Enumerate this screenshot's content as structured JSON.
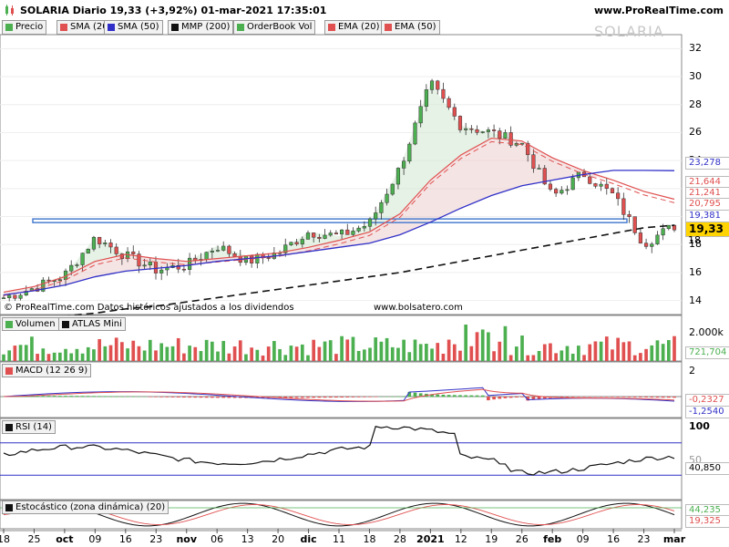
{
  "header": {
    "title": "SOLARIA Diario 19,33 (+3,92%) 01-mar-2021 17:35:01",
    "site": "www.ProRealTime.com"
  },
  "legend": [
    {
      "label": "Precio",
      "color": "#4caf50"
    },
    {
      "label": "SMA (20)",
      "color": "#e05050"
    },
    {
      "label": "SMA (50)",
      "color": "#3030c8"
    },
    {
      "label": "MMP (200)",
      "color": "#111111"
    },
    {
      "label": "OrderBook Vol",
      "color": "#4caf50"
    },
    {
      "label": "EMA (20)",
      "color": "#e05050"
    },
    {
      "label": "EMA (50)",
      "color": "#e05050"
    }
  ],
  "watermark": "SOLARIA",
  "footnotes": {
    "left": "© ProRealTime.com Datos históricos ajustados a los dividendos",
    "center": "www.bolsatero.com"
  },
  "price_axis": {
    "ticks": [
      "32",
      "30",
      "28",
      "26",
      "24",
      "18",
      "16",
      "14"
    ],
    "level_labels": [
      {
        "text": "23,278",
        "color": "#3030c8"
      },
      {
        "text": "21,644",
        "color": "#e05050"
      },
      {
        "text": "21,241",
        "color": "#e05050"
      },
      {
        "text": "20,795",
        "color": "#e05050"
      },
      {
        "text": "19,381",
        "color": "#3030c8"
      },
      {
        "text": "19,33",
        "color": "#000000"
      },
      {
        "text": "18",
        "color": "#000000"
      }
    ]
  },
  "volume_panel": {
    "labels": [
      "Volumen",
      "ATLAS Mini"
    ],
    "ticks": [
      "2.000k"
    ],
    "last": "721,704"
  },
  "macd_panel": {
    "label": "MACD (12 26 9)",
    "ticks": [
      "2"
    ],
    "values": [
      "-0,2327",
      "-1,2540"
    ]
  },
  "rsi_panel": {
    "label": "RSI (14)",
    "ticks": [
      "100",
      "50"
    ],
    "last": "40,850"
  },
  "stoch_panel": {
    "label": "Estocástico (zona dinámica) (20)",
    "values": [
      "44,235",
      "19,325"
    ]
  },
  "colors": {
    "up": "#4caf50",
    "down": "#e05050",
    "sma20": "#e05050",
    "sma50": "#3030c8",
    "mmp200": "#111111",
    "resistance": "#4a7fd0"
  },
  "x_axis": [
    "18",
    "25",
    "oct",
    "09",
    "16",
    "23",
    "nov",
    "06",
    "13",
    "20",
    "dic",
    "11",
    "18",
    "28",
    "2021",
    "12",
    "19",
    "26",
    "feb",
    "09",
    "16",
    "23",
    "mar"
  ],
  "chart_data": {
    "type": "line",
    "title": "SOLARIA Diario",
    "x": [
      "18",
      "25",
      "oct",
      "09",
      "16",
      "23",
      "nov",
      "06",
      "13",
      "20",
      "dic",
      "11",
      "18",
      "28",
      "2021",
      "12",
      "19",
      "26",
      "feb",
      "09",
      "16",
      "23",
      "mar"
    ],
    "series": [
      {
        "name": "Precio",
        "values": [
          14.2,
          14.9,
          15.8,
          18.5,
          17.2,
          16.2,
          16.5,
          17.9,
          16.8,
          17.4,
          18.9,
          18.6,
          19.5,
          23.5,
          29.5,
          26.5,
          26.0,
          25.2,
          21.4,
          23.1,
          21.5,
          18.1,
          19.33
        ]
      },
      {
        "name": "SMA (20)",
        "values": [
          14.6,
          15.0,
          15.7,
          16.8,
          17.3,
          17.0,
          16.8,
          17.0,
          17.2,
          17.4,
          17.8,
          18.3,
          18.9,
          20.2,
          22.6,
          24.4,
          25.6,
          25.4,
          24.2,
          23.3,
          22.6,
          21.8,
          21.24
        ]
      },
      {
        "name": "SMA (50)",
        "values": [
          14.4,
          14.7,
          15.1,
          15.7,
          16.1,
          16.3,
          16.5,
          16.8,
          17.0,
          17.2,
          17.5,
          17.8,
          18.1,
          18.7,
          19.6,
          20.6,
          21.5,
          22.2,
          22.6,
          23.0,
          23.3,
          23.3,
          23.28
        ]
      },
      {
        "name": "MMP (200)",
        "values": [
          12.5,
          12.7,
          12.9,
          13.1,
          13.4,
          13.6,
          13.9,
          14.2,
          14.5,
          14.8,
          15.1,
          15.4,
          15.7,
          16.0,
          16.4,
          16.8,
          17.2,
          17.6,
          18.0,
          18.4,
          18.8,
          19.2,
          19.38
        ]
      }
    ],
    "ylim": [
      13,
      33
    ]
  }
}
